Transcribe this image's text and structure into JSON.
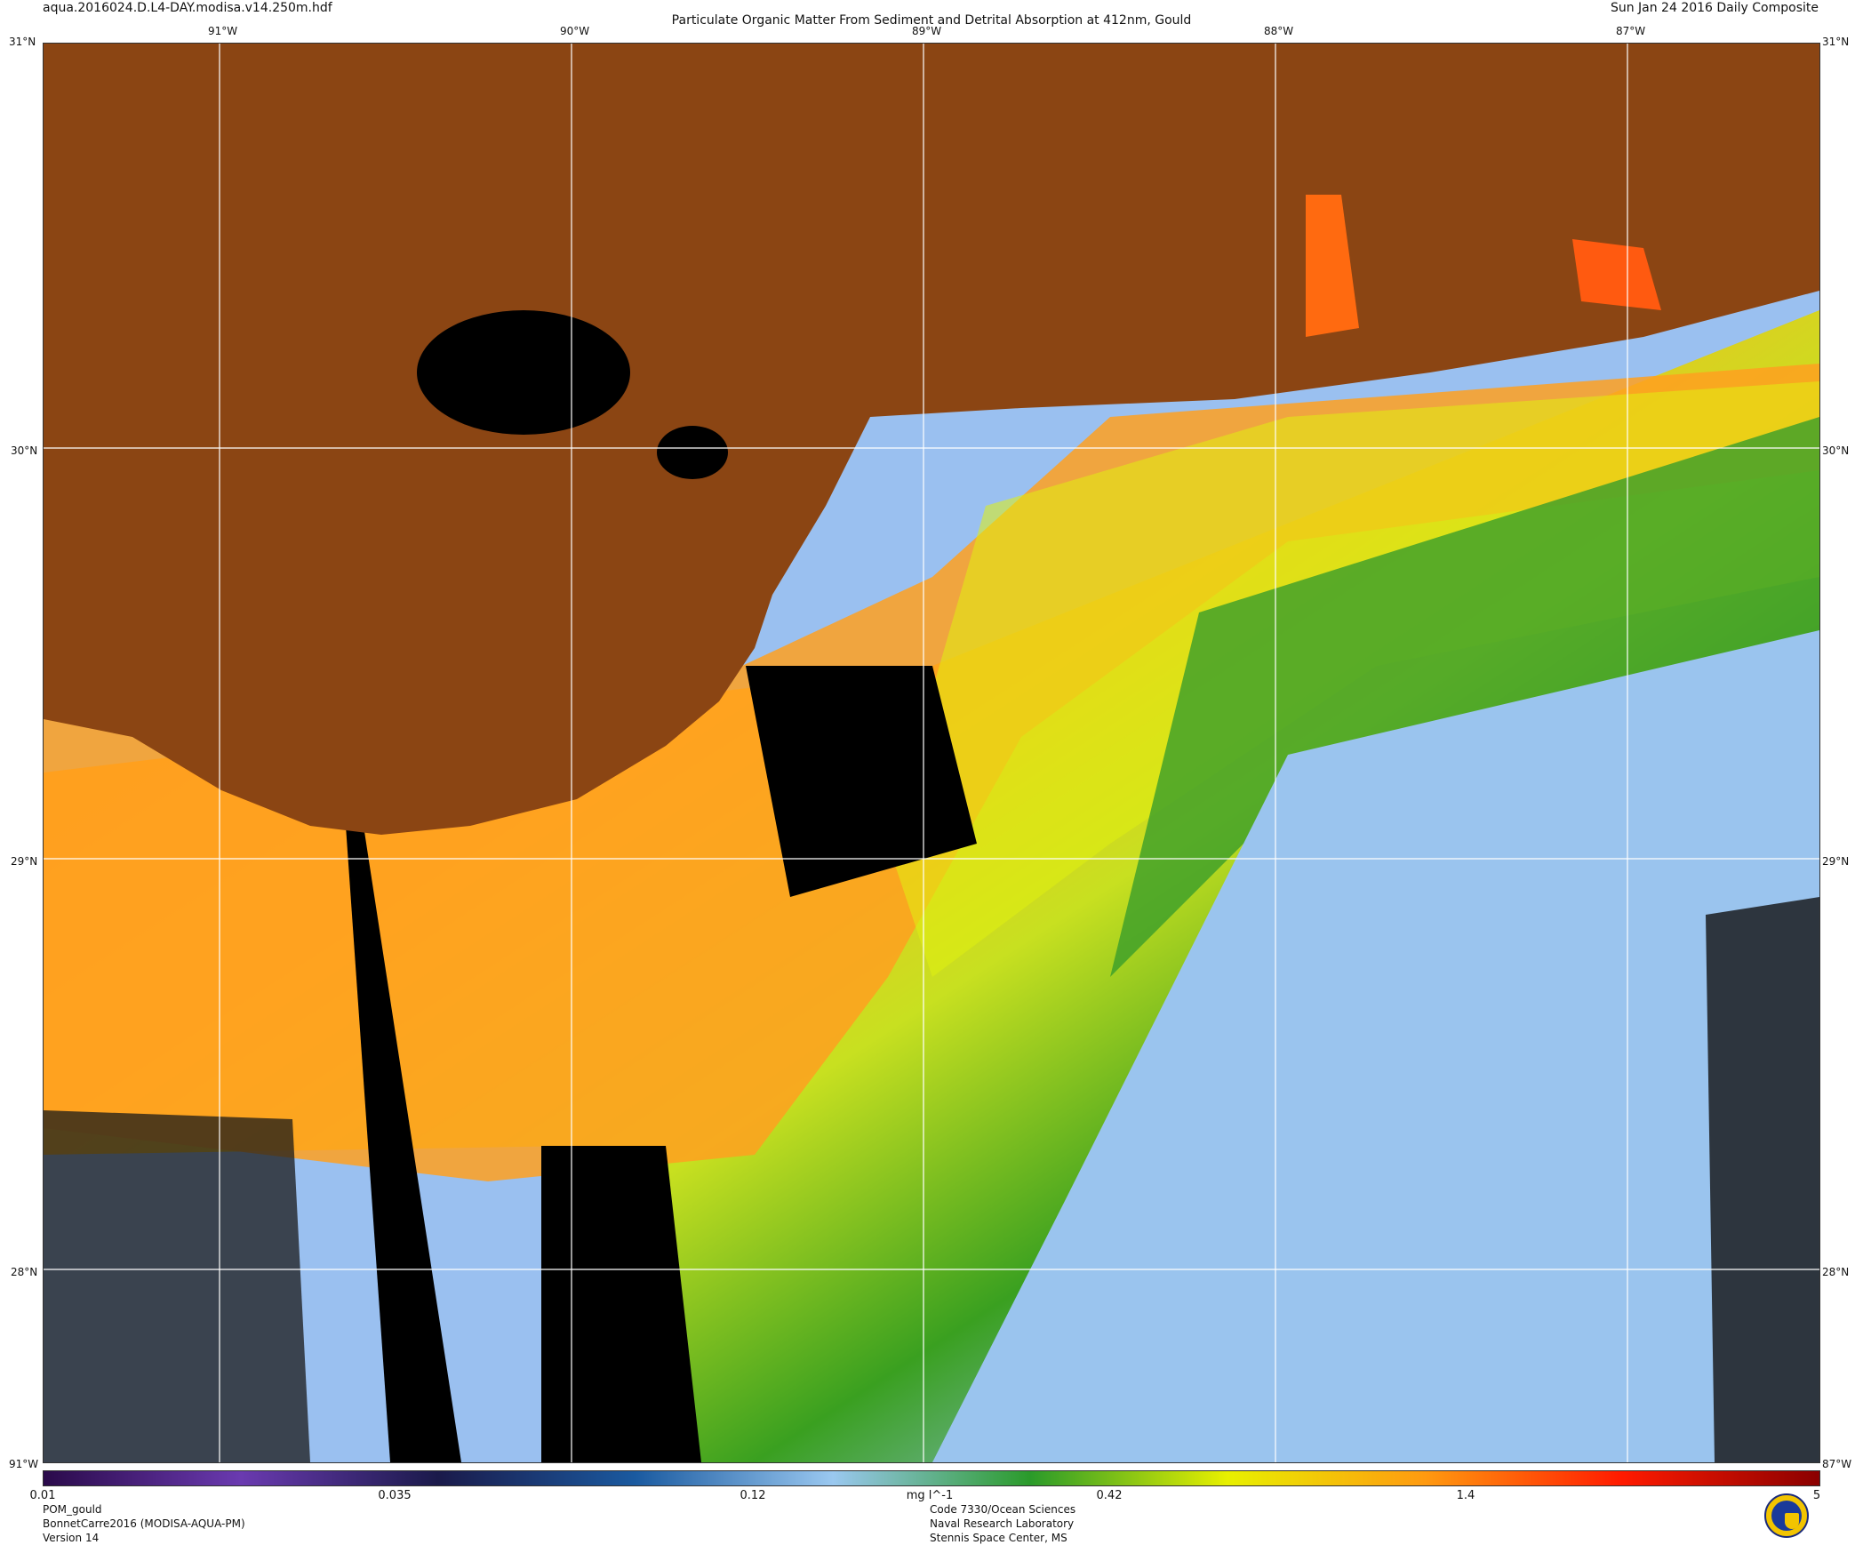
{
  "header": {
    "file_name": "aqua.2016024.D.L4-DAY.modisa.v14.250m.hdf",
    "title": "Particulate Organic Matter From Sediment and Detrital Absorption at 412nm, Gould",
    "composite": "Sun Jan 24 2016 Daily Composite"
  },
  "map": {
    "top_labels": [
      "91°W",
      "90°W",
      "89°W",
      "88°W",
      "87°W"
    ],
    "bottom_labels": [
      "91°W",
      "90°W",
      "89°W",
      "88°W",
      "87°W"
    ],
    "left_labels": [
      "31°N",
      "30°N",
      "29°N",
      "28°N"
    ],
    "right_labels": [
      "31°N",
      "30°N",
      "29°N",
      "28°N"
    ],
    "corner_top_left": "31°N",
    "corner_top_right": "31°N",
    "corner_bottom_left": "91°W",
    "corner_bottom_right": "87°W",
    "colors": {
      "land": "#8B4513",
      "no_data": "#000000",
      "coast": "#ffffff",
      "grid": "#ffffff"
    }
  },
  "colorbar": {
    "ticks": [
      "0.01",
      "0.035",
      "0.12",
      "0.42",
      "1.4",
      "5"
    ],
    "unit": "mg l^-1",
    "colors": [
      "#2a0a4a",
      "#6a3ab0",
      "#1a1a4a",
      "#1a5aa0",
      "#9ac8f0",
      "#2a9a2a",
      "#e8f000",
      "#ff9a10",
      "#ff1a00",
      "#8a0000"
    ]
  },
  "footer": {
    "left": [
      "POM_gould",
      "BonnetCarre2016 (MODISA-AQUA-PM)",
      "Version 14"
    ],
    "mid": [
      "Code 7330/Ocean Sciences",
      "Naval Research Laboratory",
      "Stennis Space Center, MS"
    ]
  },
  "logo_icon": "nrl-seal-icon"
}
